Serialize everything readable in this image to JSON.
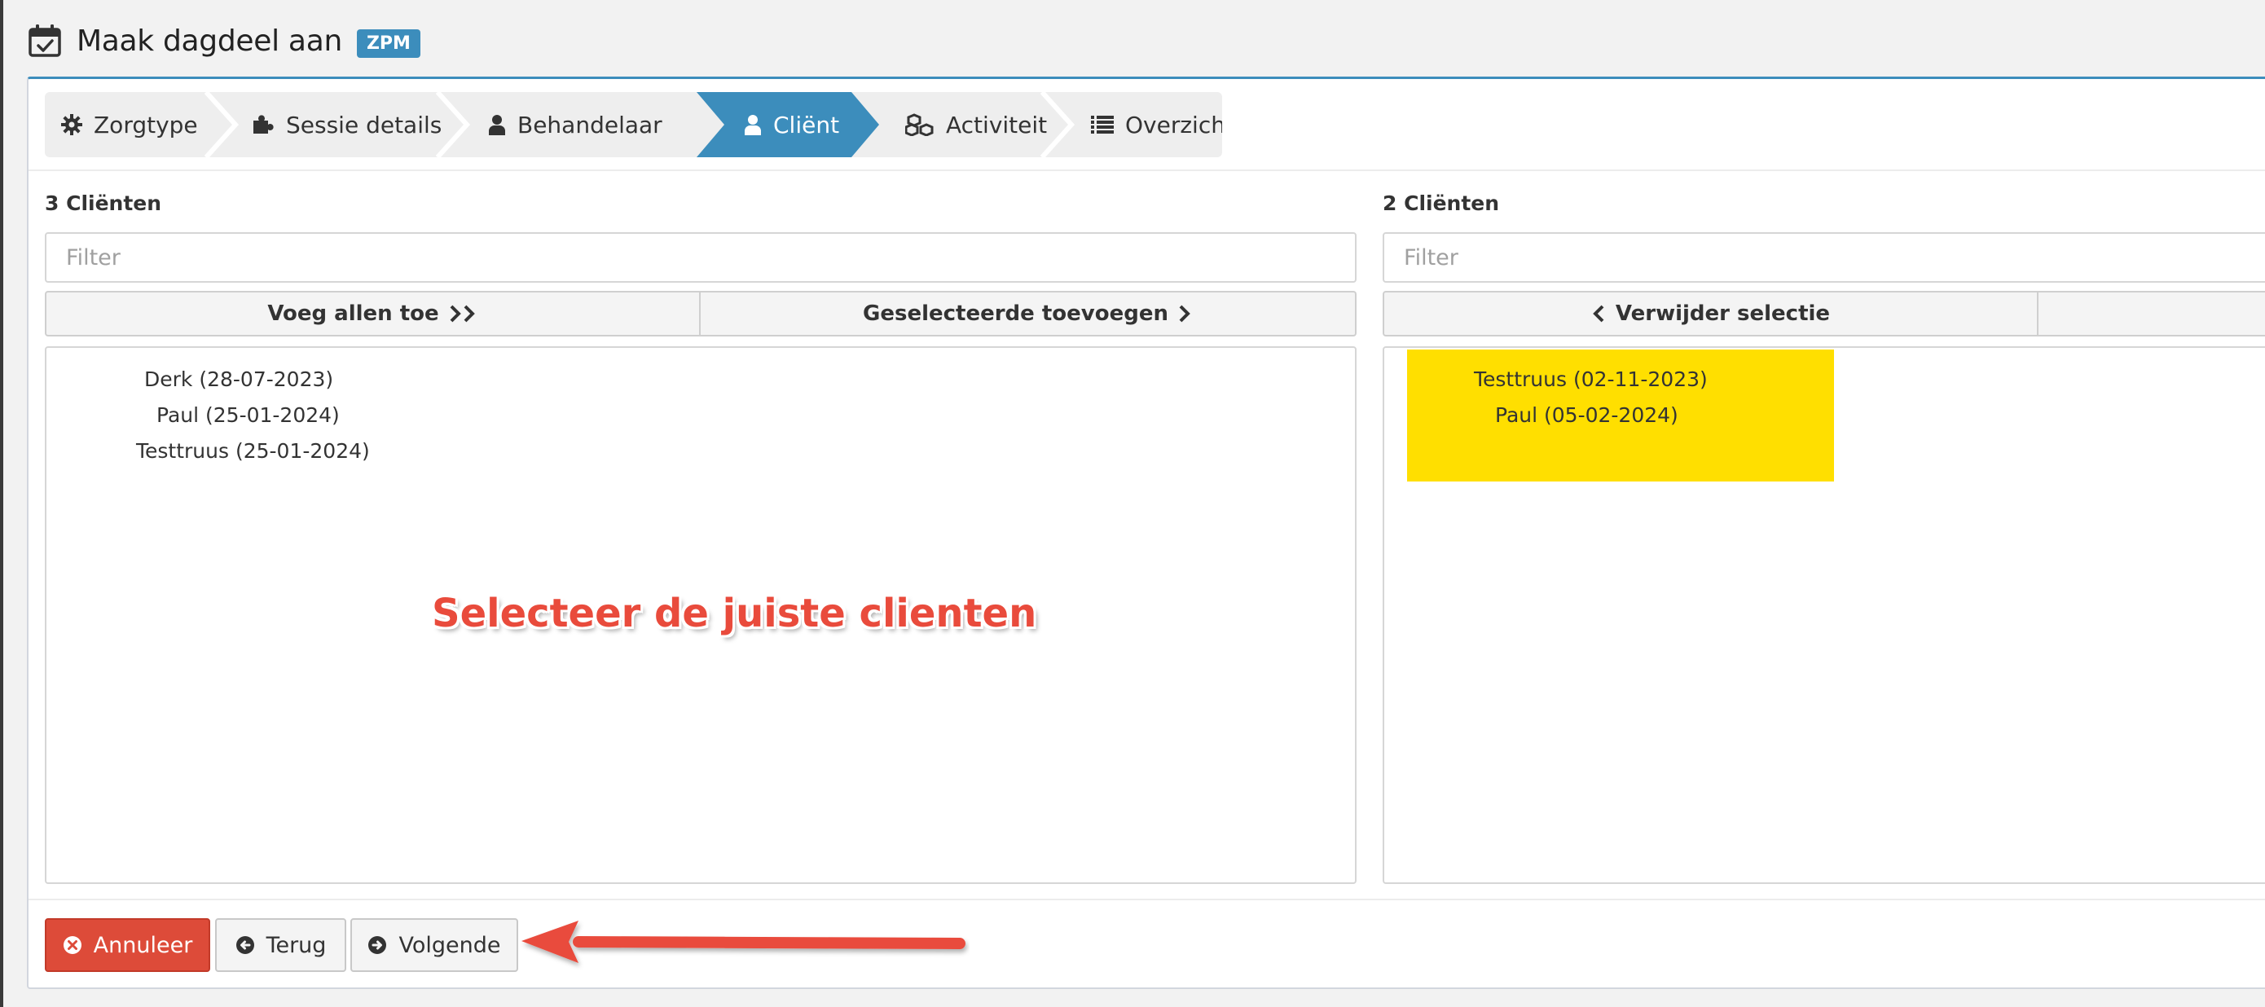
{
  "header": {
    "title": "Maak dagdeel aan",
    "badge": "ZPM"
  },
  "wizard": {
    "steps": [
      {
        "label": "Zorgtype",
        "icon": "gear-icon"
      },
      {
        "label": "Sessie details",
        "icon": "puzzle-icon"
      },
      {
        "label": "Behandelaar",
        "icon": "user-icon"
      },
      {
        "label": "Cliënt",
        "icon": "user-icon"
      },
      {
        "label": "Activiteit",
        "icon": "cubes-icon"
      },
      {
        "label": "Overzicht",
        "icon": "list-icon"
      }
    ],
    "active_step": "Cliënt"
  },
  "available": {
    "count_label": "3 Cliënten",
    "filter_placeholder": "Filter",
    "add_all_label": "Voeg allen toe",
    "add_selected_label": "Geselecteerde toevoegen",
    "items": [
      "Derk (28-07-2023)",
      "Paul (25-01-2024)",
      "Testtruus (25-01-2024)"
    ]
  },
  "selected": {
    "count_label": "2 Cliënten",
    "filter_placeholder": "Filter",
    "remove_selection_label": "Verwijder selectie",
    "items": [
      "Testtruus (02-11-2023)",
      "Paul (05-02-2024)"
    ],
    "highlight_color": "#ffdf00"
  },
  "annotation": {
    "text": "Selecteer de juiste clienten",
    "color": "#e94b3c"
  },
  "footer": {
    "cancel_label": "Annuleer",
    "back_label": "Terug",
    "next_label": "Volgende"
  },
  "colors": {
    "primary": "#3c8dbc",
    "danger": "#dd4b39"
  }
}
